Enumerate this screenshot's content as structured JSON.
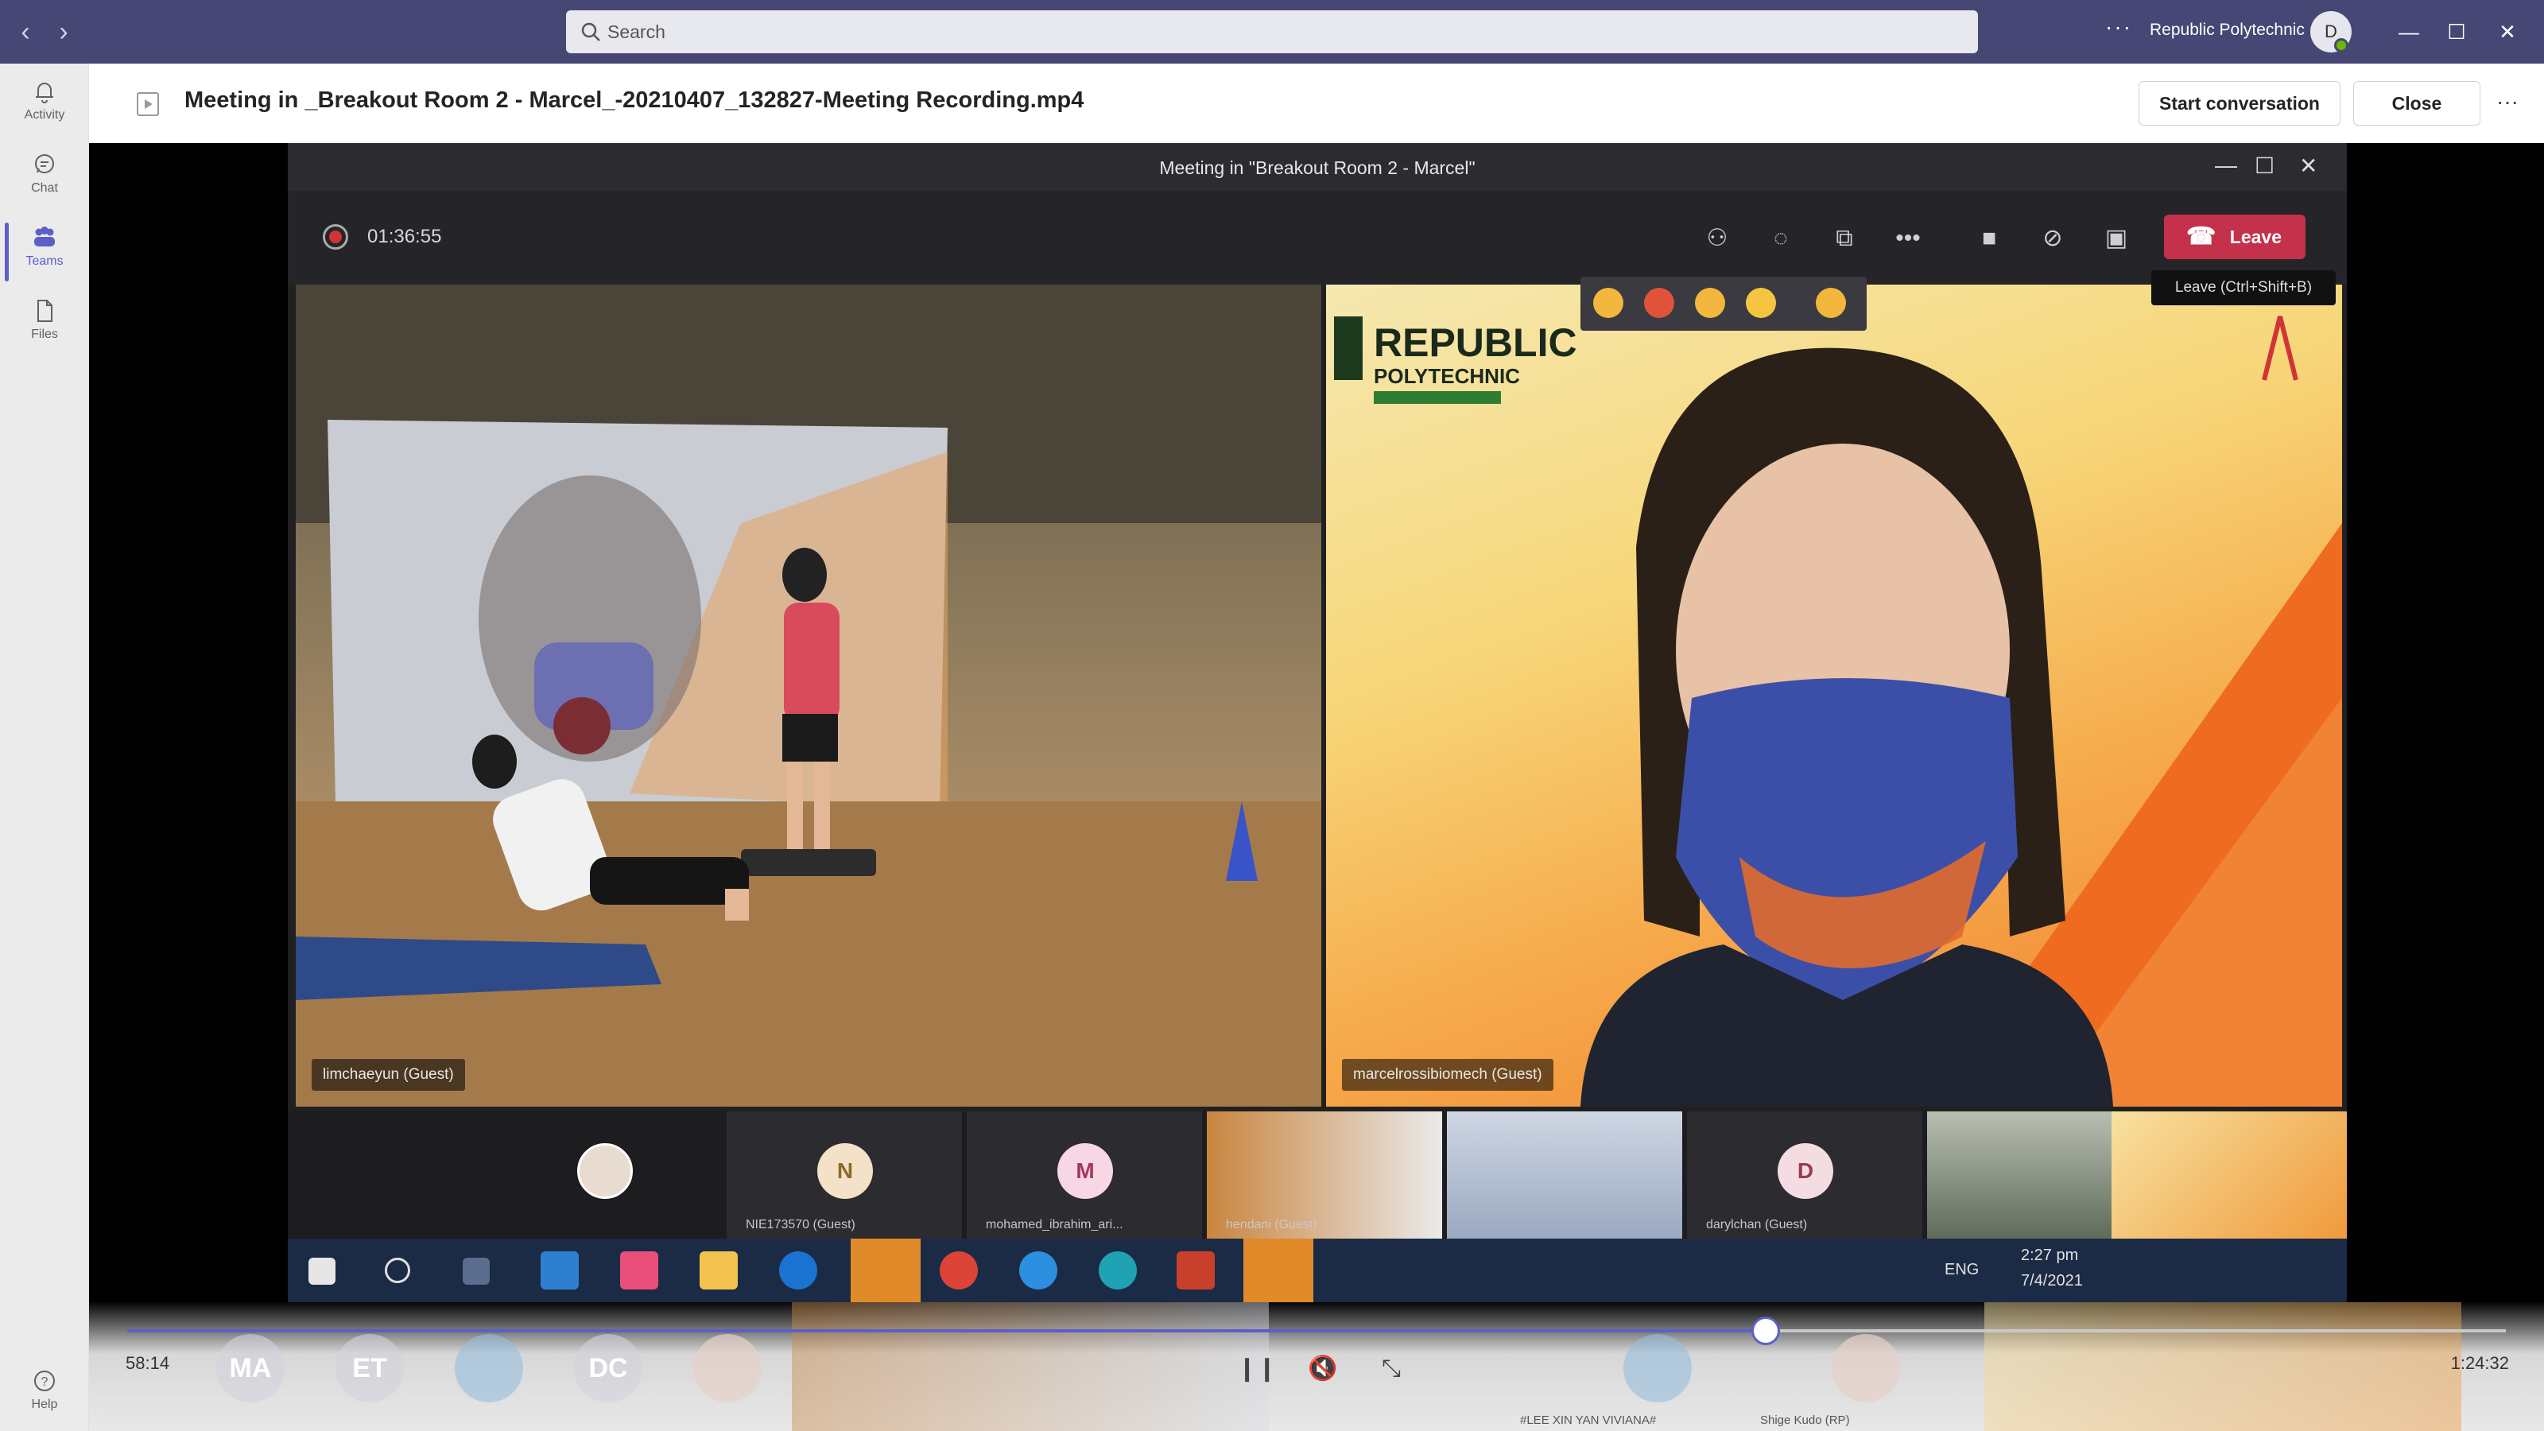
{
  "titlebar": {
    "search_placeholder": "Search",
    "more": "···",
    "org_name": "Republic Polytechnic",
    "avatar_initial": "D"
  },
  "rail": {
    "items": [
      {
        "label": "Activity",
        "icon": "bell-icon"
      },
      {
        "label": "Chat",
        "icon": "chat-icon"
      },
      {
        "label": "Teams",
        "icon": "teams-icon",
        "active": true
      },
      {
        "label": "Files",
        "icon": "file-icon"
      }
    ],
    "help": "Help"
  },
  "header": {
    "title": "Meeting in _Breakout Room 2 - Marcel_-20210407_132827-Meeting Recording.mp4",
    "start_conversation": "Start conversation",
    "close": "Close",
    "more": "···"
  },
  "video": {
    "meeting_title": "Meeting in \"Breakout Room 2 - Marcel\"",
    "recording_time": "01:36:55",
    "leave_label": "Leave",
    "leave_tooltip": "Leave (Ctrl+Shift+B)",
    "left_tile_label": "limchaeyun (Guest)",
    "right_tile_label": "marcelrossibiomech (Guest)",
    "brand_line1": "REPUBLIC",
    "brand_line2": "POLYTECHNIC",
    "participants": [
      {
        "initial": "",
        "label": "",
        "type": "photo"
      },
      {
        "initial": "N",
        "label": "NIE173570 (Guest)",
        "bg": "#f3e2c7",
        "fg": "#8a6a2a"
      },
      {
        "initial": "M",
        "label": "mohamed_ibrahim_ari...",
        "bg": "#f7d7e3",
        "fg": "#a4375f"
      },
      {
        "initial": "",
        "label": "hendani (Guest)",
        "type": "video"
      },
      {
        "initial": "",
        "label": "",
        "type": "video2"
      },
      {
        "initial": "D",
        "label": "darylchan (Guest)",
        "bg": "#f3dde3",
        "fg": "#9b3a53"
      },
      {
        "initial": "",
        "label": "",
        "type": "video3"
      },
      {
        "initial": "",
        "label": "",
        "type": "video4"
      }
    ],
    "taskbar_lang": "ENG",
    "taskbar_time": "2:27 pm",
    "taskbar_date": "7/4/2021"
  },
  "playback": {
    "current_time": "58:14",
    "total_time": "1:24:32",
    "progress": 0.689,
    "ghost_participants": [
      "MA",
      "ET",
      "",
      "DC"
    ],
    "ghost_names": [
      "#LEE XIN YAN VIVIANA#",
      "Shige Kudo (RP)"
    ]
  },
  "colors": {
    "titlebar": "#464775",
    "accent": "#5b5fc7",
    "leave": "#c4314b"
  }
}
